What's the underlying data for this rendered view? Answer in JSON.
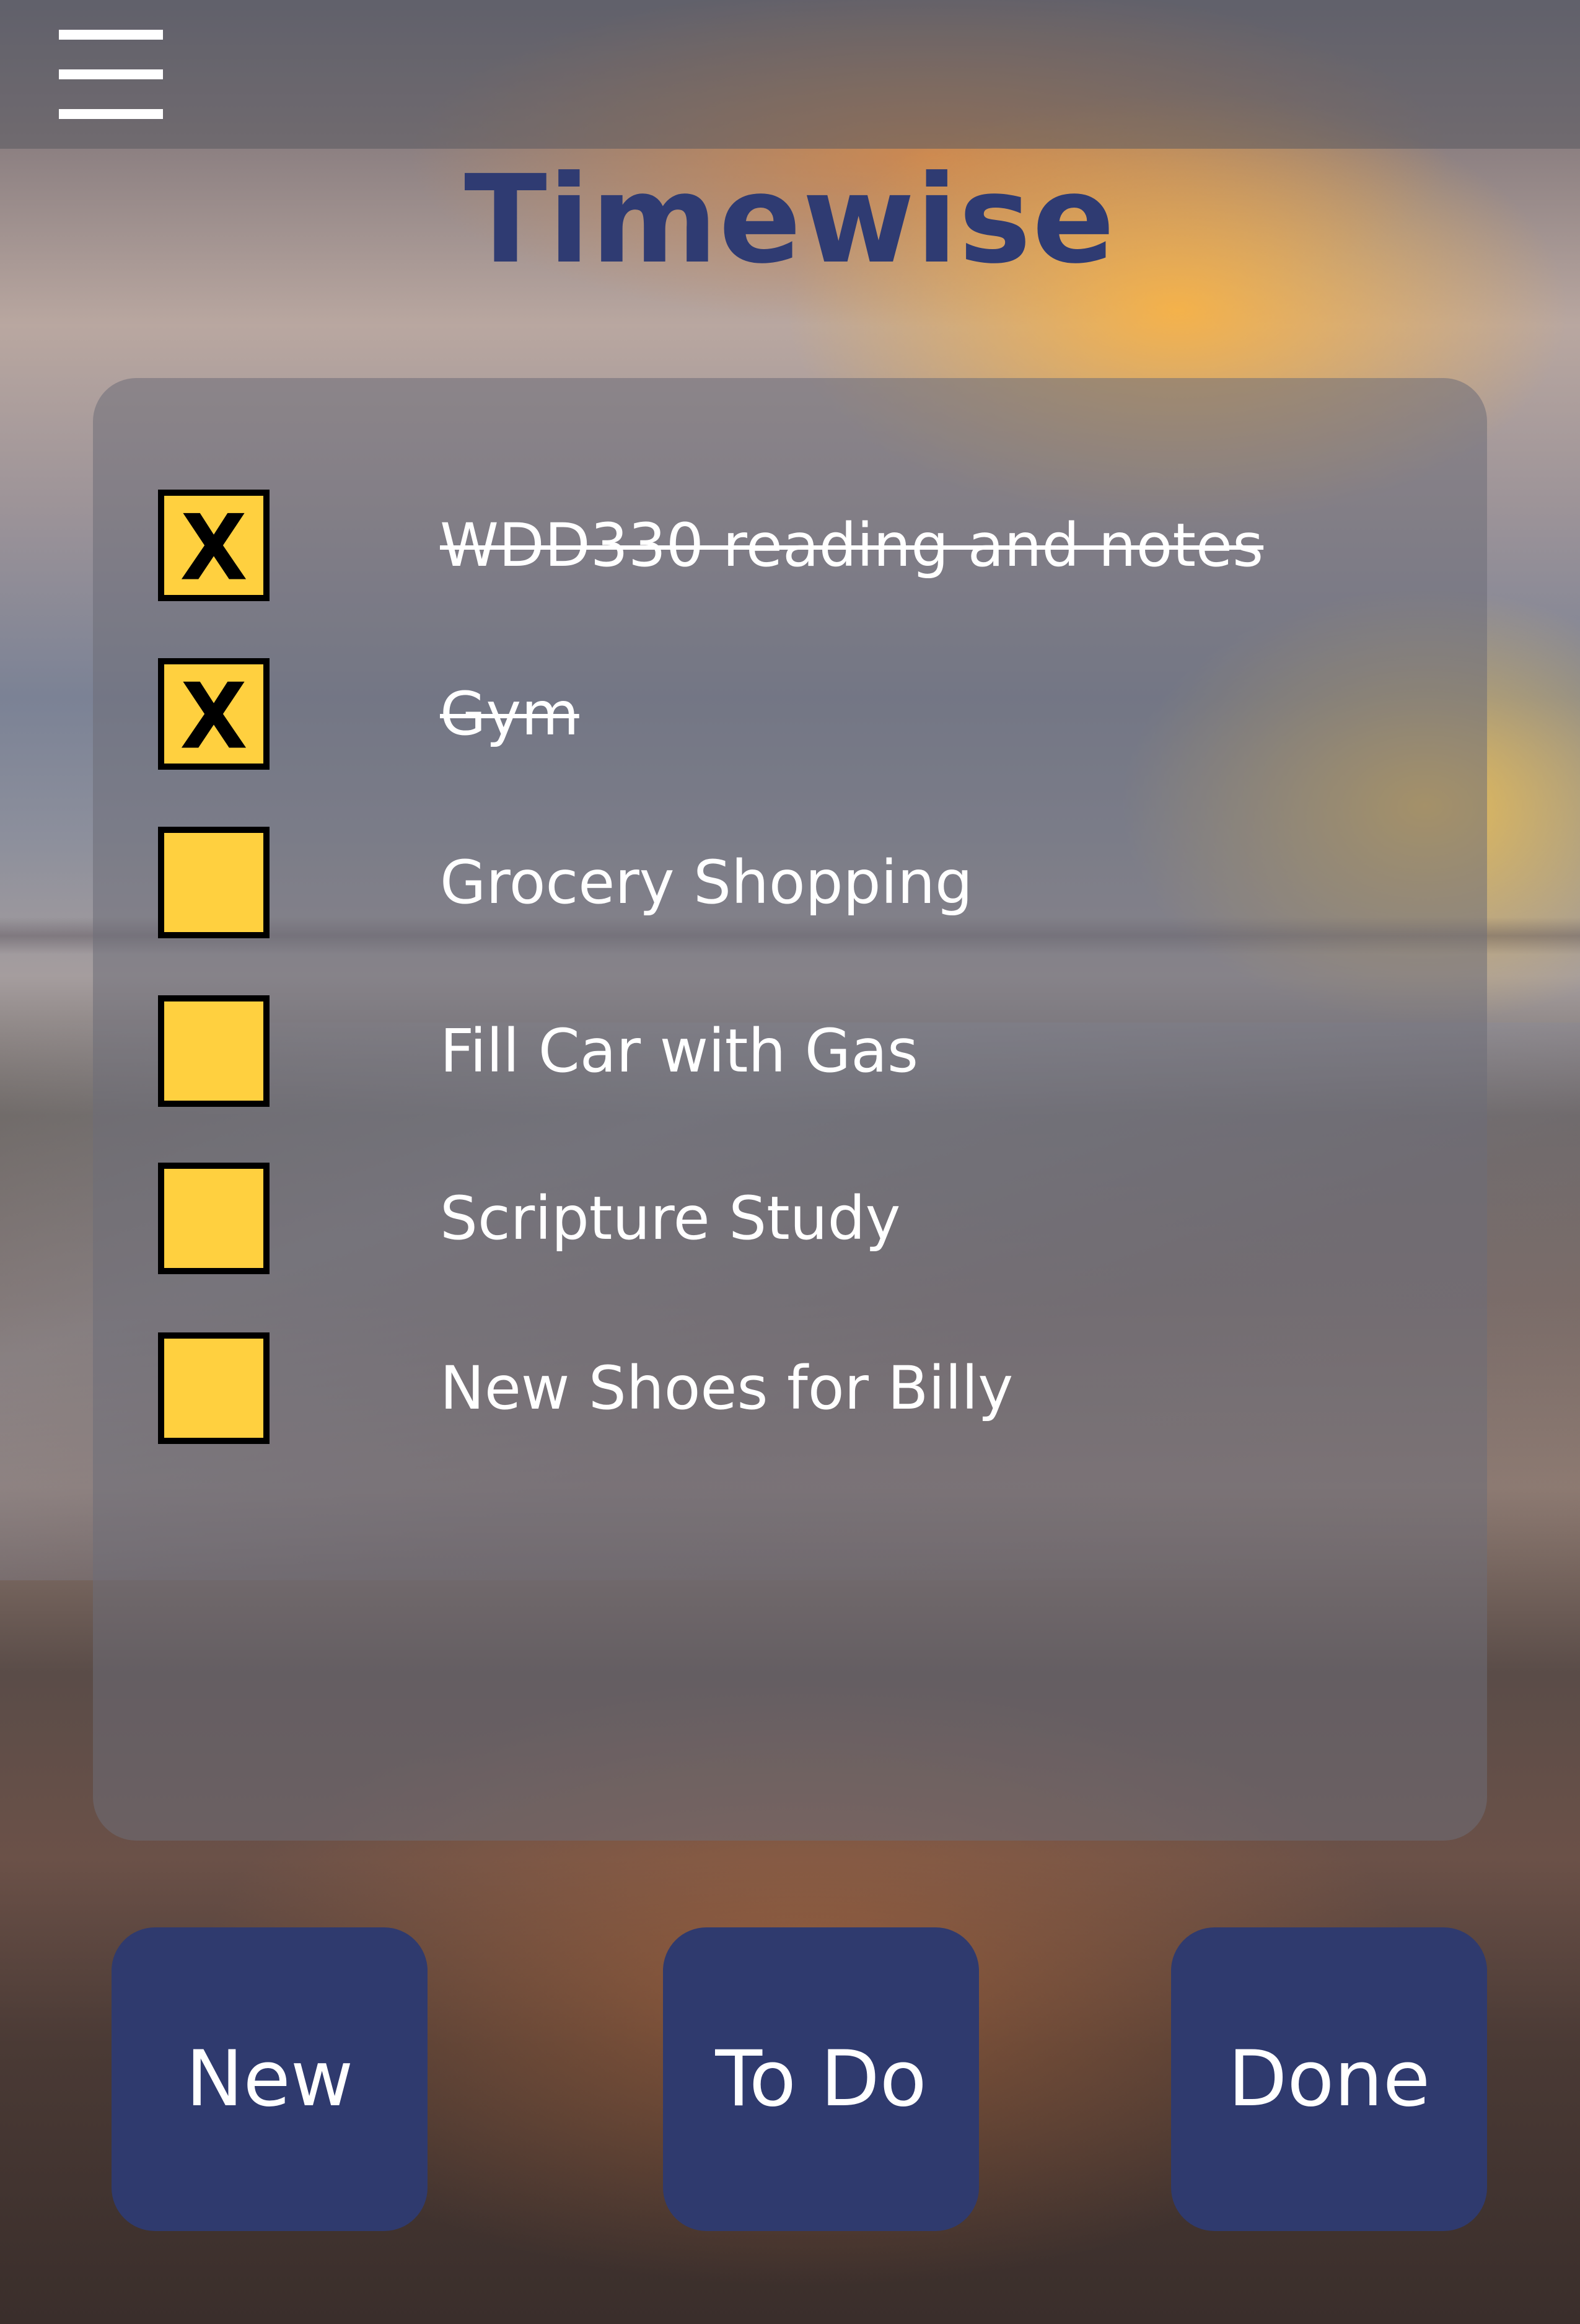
{
  "header": {
    "menu_icon": "hamburger-menu-icon"
  },
  "app": {
    "title": "Timewise"
  },
  "tasks": [
    {
      "label": "WDD330 reading and notes",
      "checked": true
    },
    {
      "label": "Gym",
      "checked": true
    },
    {
      "label": "Grocery Shopping",
      "checked": false
    },
    {
      "label": "Fill Car with Gas",
      "checked": false
    },
    {
      "label": "Scripture Study",
      "checked": false
    },
    {
      "label": "New Shoes for Billy",
      "checked": false
    }
  ],
  "footer": {
    "new_label": "New",
    "todo_label": "To Do",
    "done_label": "Done"
  },
  "colors": {
    "accent": "#2f3a6e",
    "checkbox_fill": "#ffd03f",
    "title_color": "#2f3b72"
  }
}
